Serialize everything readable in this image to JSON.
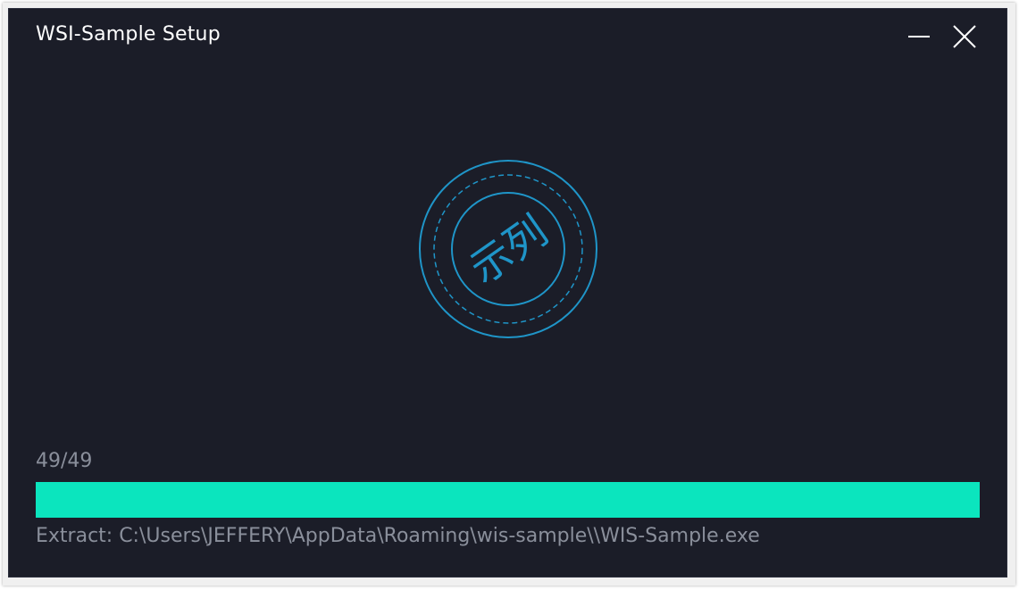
{
  "window": {
    "title": "WSI-Sample Setup"
  },
  "controls": {
    "minimize_icon": "minimize-icon",
    "close_icon": "close-icon"
  },
  "logo": {
    "text": "示列",
    "color": "#1f95c8"
  },
  "progress": {
    "count": "49/49",
    "fraction": 1.0,
    "color": "#0be5be"
  },
  "status": {
    "text": "Extract: C:\\Users\\JEFFERY\\AppData\\Roaming\\wis-sample\\\\WIS-Sample.exe"
  }
}
